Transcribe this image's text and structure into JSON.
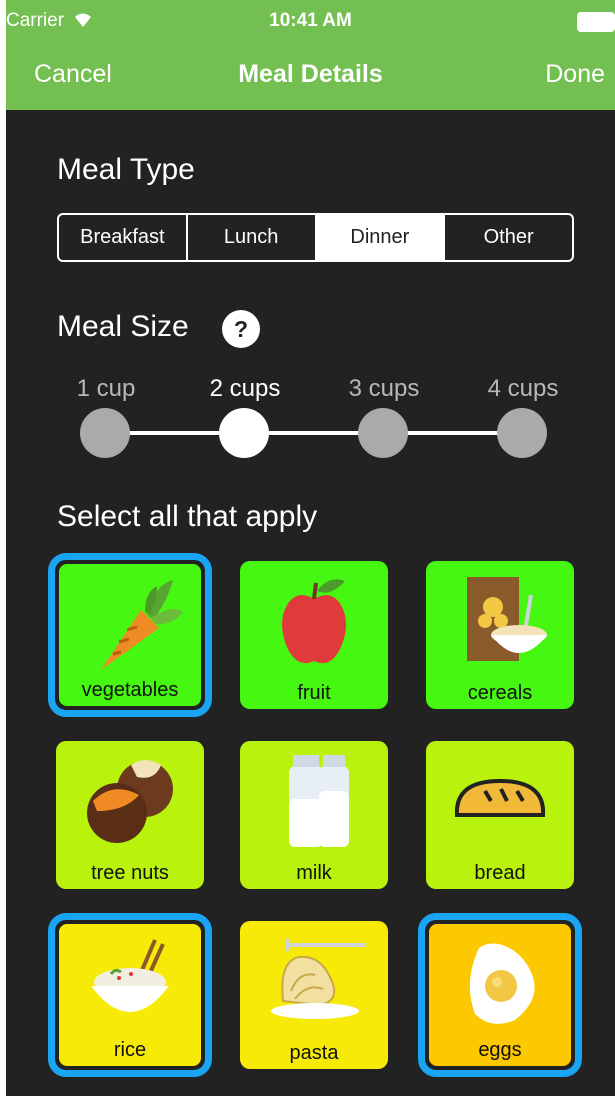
{
  "status_bar": {
    "carrier": "Carrier",
    "time": "10:41 AM"
  },
  "nav": {
    "cancel": "Cancel",
    "title": "Meal Details",
    "done": "Done"
  },
  "meal_type": {
    "heading": "Meal Type",
    "options": [
      "Breakfast",
      "Lunch",
      "Dinner",
      "Other"
    ],
    "selected": "Dinner"
  },
  "meal_size": {
    "heading": "Meal Size",
    "help": "?",
    "options": [
      "1 cup",
      "2 cups",
      "3 cups",
      "4 cups"
    ],
    "selected": "2 cups"
  },
  "food_section": {
    "heading": "Select all that apply",
    "items": [
      {
        "label": "vegetables",
        "icon": "carrot-icon",
        "color": "#45f711",
        "selected": true
      },
      {
        "label": "fruit",
        "icon": "apple-icon",
        "color": "#45f711",
        "selected": false
      },
      {
        "label": "cereals",
        "icon": "cereal-icon",
        "color": "#45f711",
        "selected": false
      },
      {
        "label": "tree nuts",
        "icon": "nuts-icon",
        "color": "#b9f20d",
        "selected": false
      },
      {
        "label": "milk",
        "icon": "milk-icon",
        "color": "#b9f20d",
        "selected": false
      },
      {
        "label": "bread",
        "icon": "bread-icon",
        "color": "#b9f20d",
        "selected": false
      },
      {
        "label": "rice",
        "icon": "rice-bowl-icon",
        "color": "#f7ea06",
        "selected": true
      },
      {
        "label": "pasta",
        "icon": "pasta-icon",
        "color": "#f7ea06",
        "selected": false
      },
      {
        "label": "eggs",
        "icon": "egg-icon",
        "color": "#fcc800",
        "selected": true
      }
    ]
  },
  "colors": {
    "header": "#74bf51",
    "background": "#222222",
    "selection": "#1aa5f2"
  }
}
